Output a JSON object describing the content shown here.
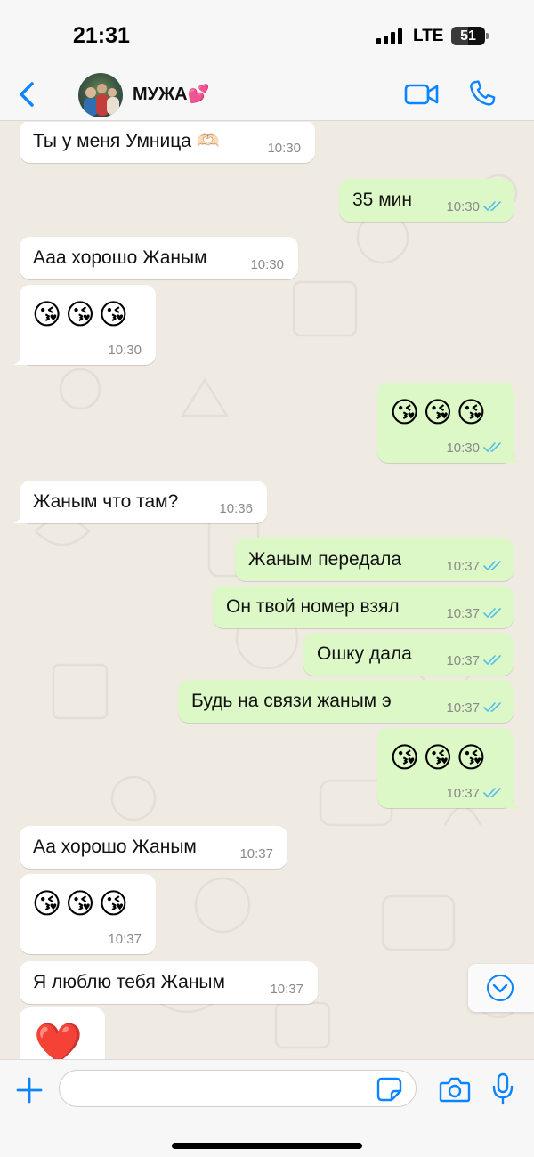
{
  "status_bar": {
    "time": "21:31",
    "network": "LTE",
    "battery": "51",
    "battery_level": 0.51
  },
  "header": {
    "contact_name": "МУЖА💕"
  },
  "messages": [
    {
      "text": "Ты у меня Умница 🫶🏻",
      "time": "10:30"
    },
    {
      "text": "35 мин",
      "time": "10:30"
    },
    {
      "text": "Ааа хорошо Жаным",
      "time": "10:30"
    },
    {
      "text": "😘😘😘",
      "time": "10:30"
    },
    {
      "text": "😘😘😘",
      "time": "10:30"
    },
    {
      "text": "Жаным что там?",
      "time": "10:36"
    },
    {
      "text": "Жаным передала",
      "time": "10:37"
    },
    {
      "text": "Он твой номер взял",
      "time": "10:37"
    },
    {
      "text": "Ошку дала",
      "time": "10:37"
    },
    {
      "text": "Будь на связи жаным э",
      "time": "10:37"
    },
    {
      "text": "😘😘😘",
      "time": "10:37"
    },
    {
      "text": "Аа хорошо Жаным",
      "time": "10:37"
    },
    {
      "text": "😘😘😘",
      "time": "10:37"
    },
    {
      "text": "Я люблю тебя Жаным",
      "time": "10:37"
    },
    {
      "text": "❤️"
    }
  ],
  "input": {
    "placeholder": ""
  },
  "colors": {
    "accent": "#0a84ff",
    "outgoing_bubble": "#dcf8c6",
    "incoming_bubble": "#ffffff",
    "read_ticks": "#53bdeb"
  }
}
